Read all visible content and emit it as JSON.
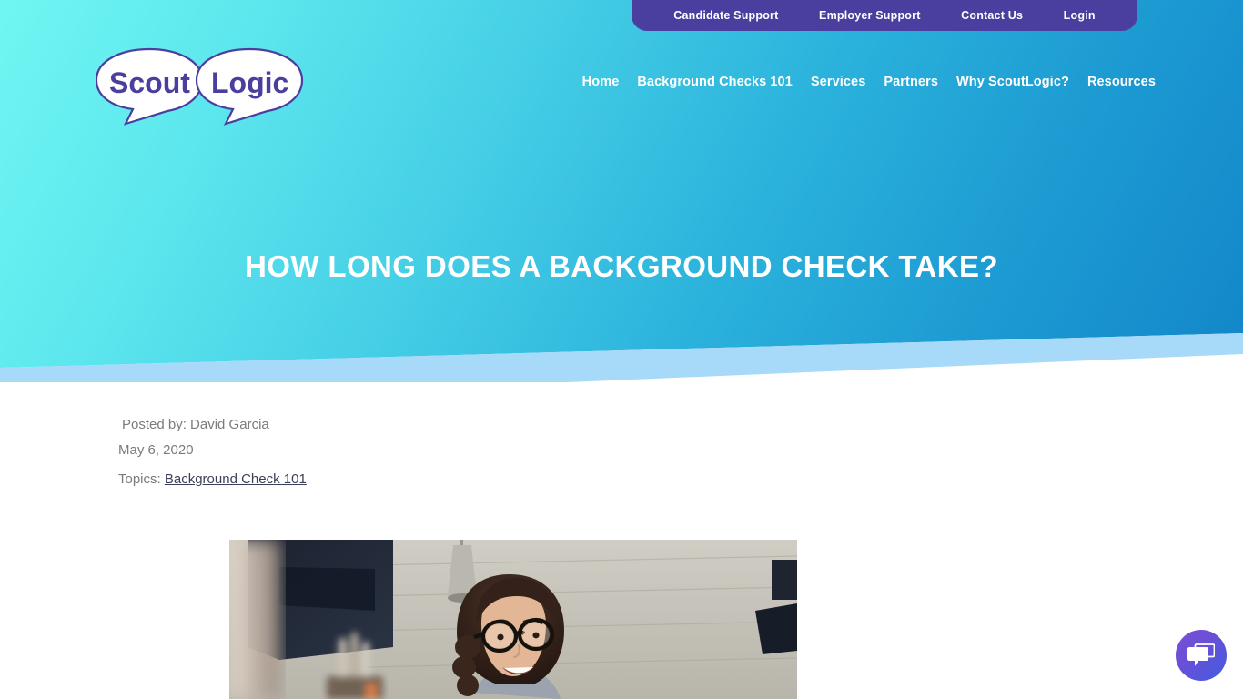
{
  "theme": {
    "hero_gradient_from": "#70f6f2",
    "hero_gradient_to": "#1386c9",
    "hero_band": "#a7d9f8",
    "topbar_purple": "#4a3f9f",
    "logo_text": "#4a3f9f",
    "meta_gray": "#7b7b7b",
    "link_navy": "#3c3f58",
    "chat_from": "#7a4fd6",
    "chat_to": "#3f5ddf"
  },
  "topbar": {
    "items": [
      {
        "label": "Candidate Support",
        "name": "topbar-candidate-support"
      },
      {
        "label": "Employer Support",
        "name": "topbar-employer-support"
      },
      {
        "label": "Contact Us",
        "name": "topbar-contact-us"
      },
      {
        "label": "Login",
        "name": "topbar-login"
      }
    ]
  },
  "logo": {
    "alt": "ScoutLogic",
    "word_left": "Scout",
    "word_right": "Logic"
  },
  "nav": {
    "items": [
      {
        "label": "Home",
        "name": "nav-home"
      },
      {
        "label": "Background Checks 101",
        "name": "nav-background-checks-101"
      },
      {
        "label": "Services",
        "name": "nav-services"
      },
      {
        "label": "Partners",
        "name": "nav-partners"
      },
      {
        "label": "Why ScoutLogic?",
        "name": "nav-why-scoutlogic"
      },
      {
        "label": "Resources",
        "name": "nav-resources"
      }
    ]
  },
  "hero": {
    "title": "HOW LONG DOES A BACKGROUND CHECK TAKE?"
  },
  "post": {
    "author_line": "Posted by: David Garcia",
    "date": "May 6, 2020",
    "topics_label": "Topics:",
    "topic_link": "Background Check 101",
    "image_alt": "Woman with glasses smiling in an office"
  },
  "chat": {
    "icon": "chat-bubbles-icon",
    "aria_label": "Open chat"
  }
}
